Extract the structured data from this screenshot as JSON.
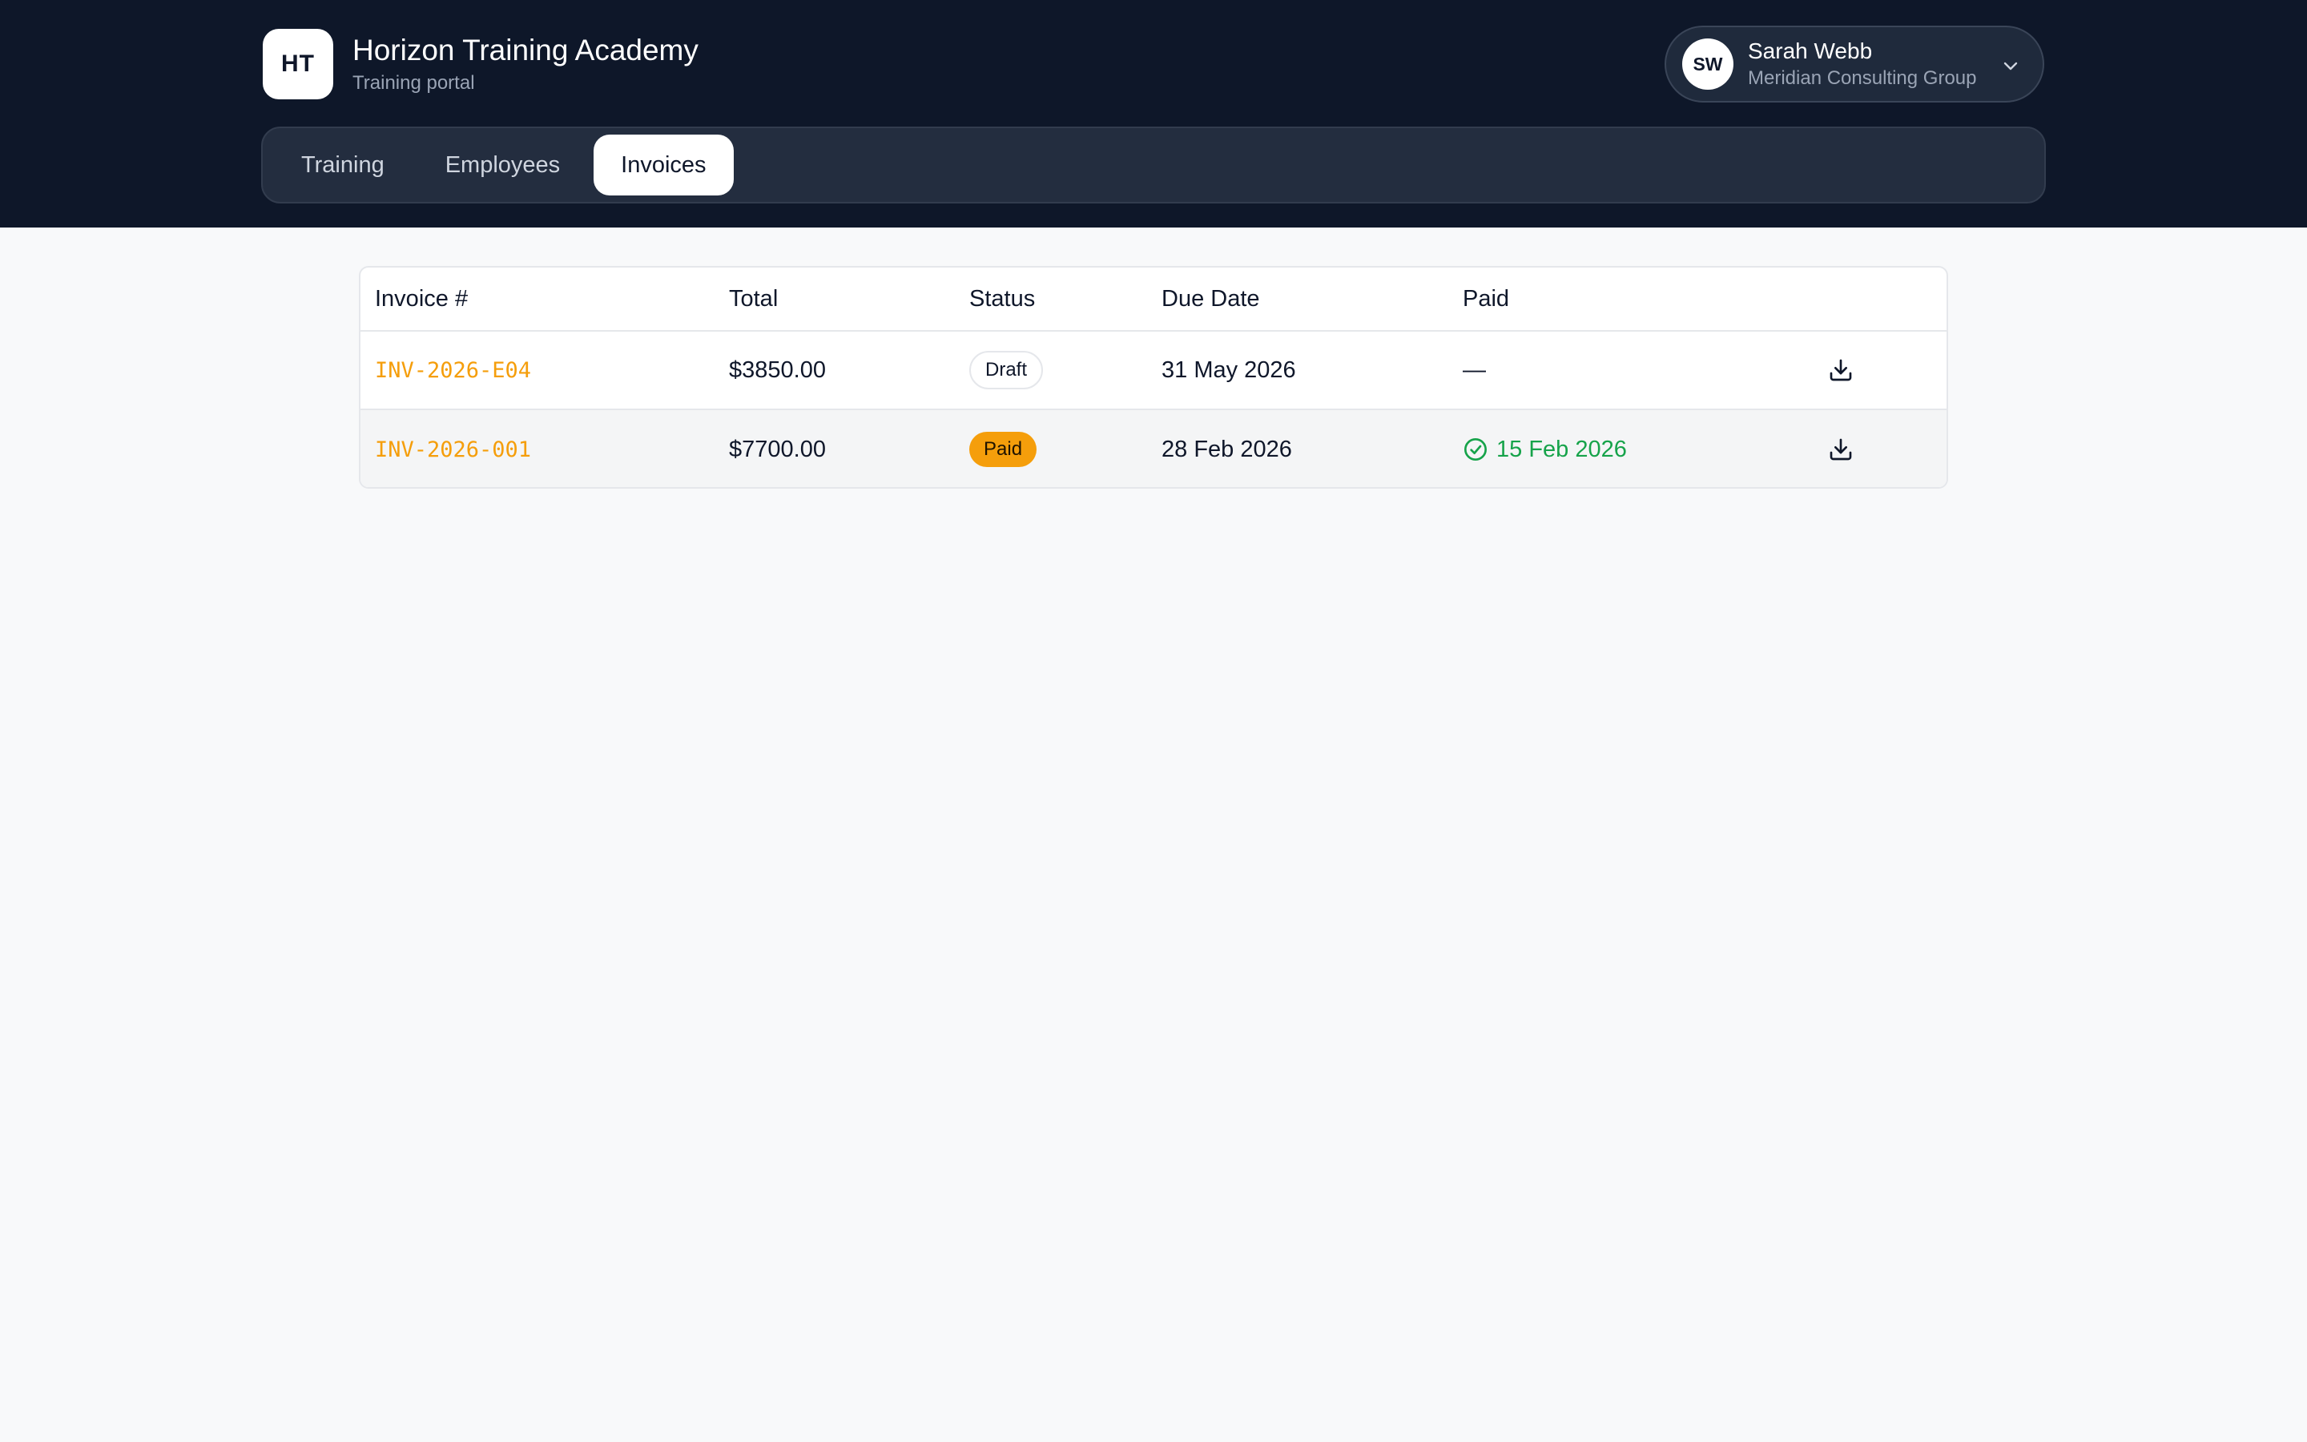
{
  "brand": {
    "logo_text": "HT",
    "title": "Horizon Training Academy",
    "subtitle": "Training portal"
  },
  "user": {
    "initials": "SW",
    "name": "Sarah Webb",
    "organization": "Meridian Consulting Group",
    "menu_icon": "chevron-down-icon"
  },
  "nav": {
    "tabs": [
      {
        "label": "Training",
        "active": false
      },
      {
        "label": "Employees",
        "active": false
      },
      {
        "label": "Invoices",
        "active": true
      }
    ]
  },
  "table": {
    "columns": [
      "Invoice #",
      "Total",
      "Status",
      "Due Date",
      "Paid",
      ""
    ],
    "rows": [
      {
        "invoice": "INV-2026-E04",
        "total": "$3850.00",
        "status": "Draft",
        "due_date": "31 May 2026",
        "paid": "—",
        "action_icon": "download-icon"
      },
      {
        "invoice": "INV-2026-001",
        "total": "$7700.00",
        "status": "Paid",
        "due_date": "28 Feb 2026",
        "paid": "15 Feb 2026",
        "paid_icon": "check-circle-icon",
        "action_icon": "download-icon"
      }
    ]
  },
  "colors": {
    "header_bg": "#0e1729",
    "accent": "#f59e0b",
    "paid_green": "#16a34a",
    "page_bg": "#f8f9fa"
  }
}
